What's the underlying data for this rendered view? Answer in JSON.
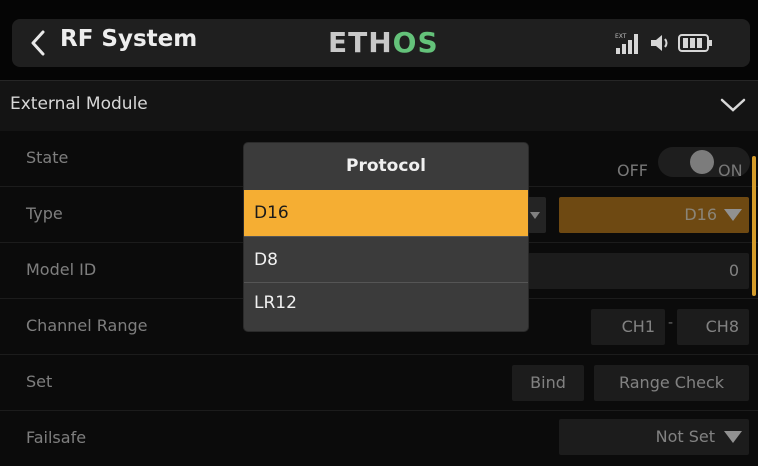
{
  "header": {
    "title": "RF System",
    "logo_left": "ETH",
    "logo_right": "OS",
    "logo_colors": {
      "left": "#c8c8c8",
      "right": "#64c27a"
    },
    "status_ext_label": "EXT"
  },
  "section": {
    "label": "External Module"
  },
  "rows": {
    "state": {
      "label": "State",
      "off_label": "OFF",
      "on_label": "ON"
    },
    "type": {
      "label": "Type",
      "value": "D16"
    },
    "model_id": {
      "label": "Model ID",
      "value": "0"
    },
    "channel_range": {
      "label": "Channel Range",
      "start": "CH1",
      "end": "CH8",
      "separator": "-"
    },
    "set": {
      "label": "Set",
      "bind": "Bind",
      "range_check": "Range Check"
    },
    "failsafe": {
      "label": "Failsafe",
      "value": "Not Set"
    }
  },
  "popup": {
    "title": "Protocol",
    "options": [
      "D16",
      "D8",
      "LR12"
    ],
    "selected": "D16"
  },
  "colors": {
    "accent": "#f5ae33",
    "type_field": "#c07d18",
    "scrollbar": "#d39b2b"
  }
}
